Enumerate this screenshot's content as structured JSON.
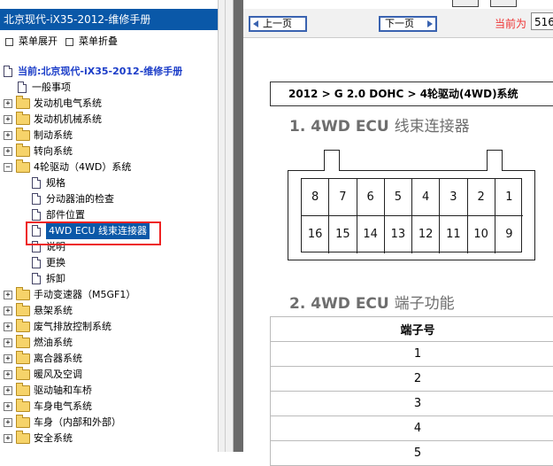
{
  "left_panel": {
    "title": "北京现代-iX35-2012-维修手册",
    "expand_label": "菜单展开",
    "collapse_label": "菜单折叠",
    "root_label": "当前:北京现代-iX35-2012-维修手册",
    "tree": [
      {
        "label": "一般事项",
        "type": "doc",
        "level": 1
      },
      {
        "label": "发动机电气系统",
        "type": "folder",
        "level": 1
      },
      {
        "label": "发动机机械系统",
        "type": "folder",
        "level": 1
      },
      {
        "label": "制动系统",
        "type": "folder",
        "level": 1
      },
      {
        "label": "转向系统",
        "type": "folder",
        "level": 1
      },
      {
        "label": "4轮驱动（4WD）系统",
        "type": "folder",
        "level": 1,
        "expanded": true
      },
      {
        "label": "规格",
        "type": "doc",
        "level": 2
      },
      {
        "label": "分动器油的检查",
        "type": "doc",
        "level": 2
      },
      {
        "label": "部件位置",
        "type": "doc",
        "level": 2
      },
      {
        "label": "4WD ECU 线束连接器",
        "type": "doc",
        "level": 2,
        "selected": true
      },
      {
        "label": "说明",
        "type": "doc",
        "level": 2
      },
      {
        "label": "更换",
        "type": "doc",
        "level": 2
      },
      {
        "label": "拆卸",
        "type": "doc",
        "level": 2
      },
      {
        "label": "手动变速器（M5GF1）",
        "type": "folder",
        "level": 1
      },
      {
        "label": "悬架系统",
        "type": "folder",
        "level": 1
      },
      {
        "label": "废气排放控制系统",
        "type": "folder",
        "level": 1
      },
      {
        "label": "燃油系统",
        "type": "folder",
        "level": 1
      },
      {
        "label": "离合器系统",
        "type": "folder",
        "level": 1
      },
      {
        "label": "暖风及空调",
        "type": "folder",
        "level": 1
      },
      {
        "label": "驱动轴和车桥",
        "type": "folder",
        "level": 1
      },
      {
        "label": "车身电气系统",
        "type": "folder",
        "level": 1
      },
      {
        "label": "车身（内部和外部）",
        "type": "folder",
        "level": 1
      },
      {
        "label": "安全系统",
        "type": "folder",
        "level": 1
      }
    ]
  },
  "toolbar": {
    "prev_label": "上一页",
    "next_label": "下一页",
    "current_label": "当前为",
    "current_value": "516"
  },
  "content": {
    "breadcrumb": "2012 > G 2.0 DOHC > 4轮驱动(4WD)系统",
    "section1_num": "1. 4WD ECU",
    "section1_title": "线束连接器",
    "connector_pins_top": [
      "8",
      "7",
      "6",
      "5",
      "4",
      "3",
      "2",
      "1"
    ],
    "connector_pins_bottom": [
      "16",
      "15",
      "14",
      "13",
      "12",
      "11",
      "10",
      "9"
    ],
    "section2_num": "2. 4WD ECU",
    "section2_title": "端子功能",
    "table_header": "端子号",
    "table_rows": [
      "1",
      "2",
      "3",
      "4",
      "5"
    ]
  },
  "colors": {
    "title_bg": "#0a58a8",
    "root_text": "#1a3cc8",
    "highlight_box": "#e22222",
    "current_label": "#e33333"
  }
}
